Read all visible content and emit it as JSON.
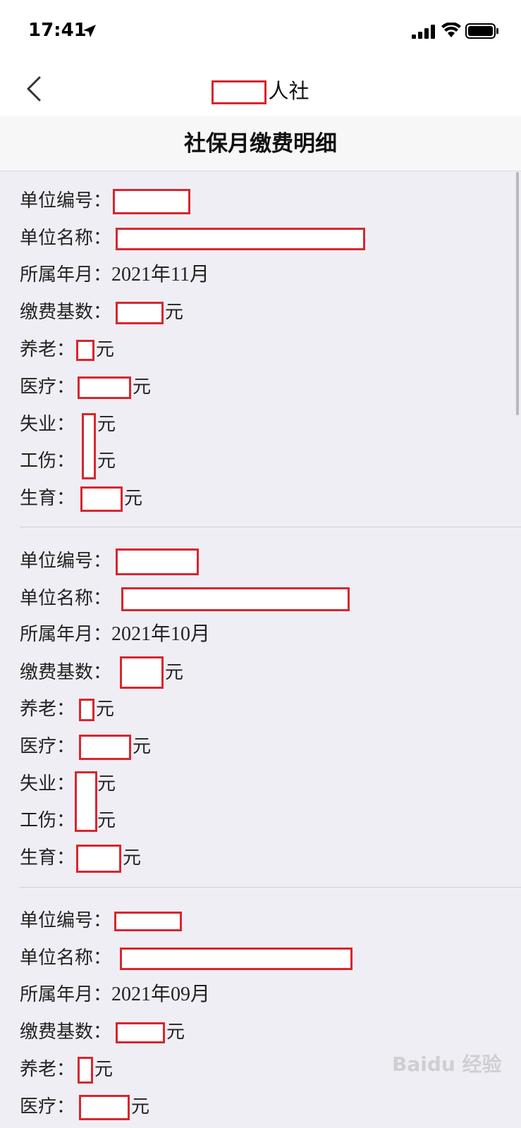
{
  "status_bar": {
    "time": "17:41"
  },
  "nav": {
    "title_suffix": "人社"
  },
  "header": {
    "title": "社保月缴费明细"
  },
  "labels": {
    "unit_no": "单位编号：",
    "unit_name": "单位名称：",
    "period": "所属年月：",
    "base": "缴费基数：",
    "pension": "养老：",
    "medical": "医疗：",
    "unemployment": "失业：",
    "injury": "工伤：",
    "maternity": "生育：",
    "currency": "元"
  },
  "records": [
    {
      "period": "2021年11月"
    },
    {
      "period": "2021年10月"
    },
    {
      "period": "2021年09月"
    }
  ],
  "colors": {
    "redaction": "#d8262e",
    "background": "#efeef4"
  },
  "watermark": "Baidu 经验"
}
